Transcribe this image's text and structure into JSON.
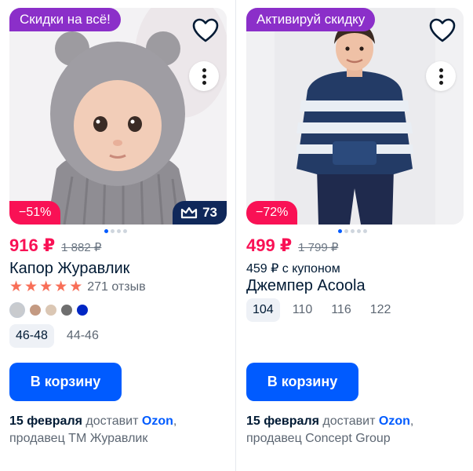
{
  "products": [
    {
      "promo_label": "Скидки на всё!",
      "discount": "−51%",
      "premium_badge": "73",
      "price": "916 ₽",
      "old_price": "1 882 ₽",
      "title": "Капор Журавлик",
      "rating_stars": 5,
      "reviews": "271 отзыв",
      "colors": [
        "#c9cbce",
        "#c49a82",
        "#dbc7b4",
        "#6f6f6f",
        "#0026c4"
      ],
      "sizes": [
        "46-48",
        "44-46"
      ],
      "cart_label": "В корзину",
      "delivery_date": "15 февраля",
      "delivery_text": "доставит",
      "delivery_service": "Ozon",
      "seller": "продавец ТМ Журавлик"
    },
    {
      "promo_label": "Активируй скидку",
      "discount": "−72%",
      "price": "499 ₽",
      "old_price": "1 799 ₽",
      "coupon_price": "459 ₽ с купоном",
      "title": "Джемпер Acoola",
      "sizes": [
        "104",
        "110",
        "116",
        "122"
      ],
      "cart_label": "В корзину",
      "delivery_date": "15 февраля",
      "delivery_text": "доставит",
      "delivery_service": "Ozon",
      "seller": "продавец Concept Group"
    }
  ],
  "icons": {
    "favorite": "heart-icon",
    "more": "more-vertical-icon",
    "premium": "crown-icon",
    "rating": "star-icon"
  },
  "colors": {
    "promo": "#8b2fc9",
    "discount": "#f91155",
    "accent": "#005bff",
    "premium": "#10285a"
  }
}
